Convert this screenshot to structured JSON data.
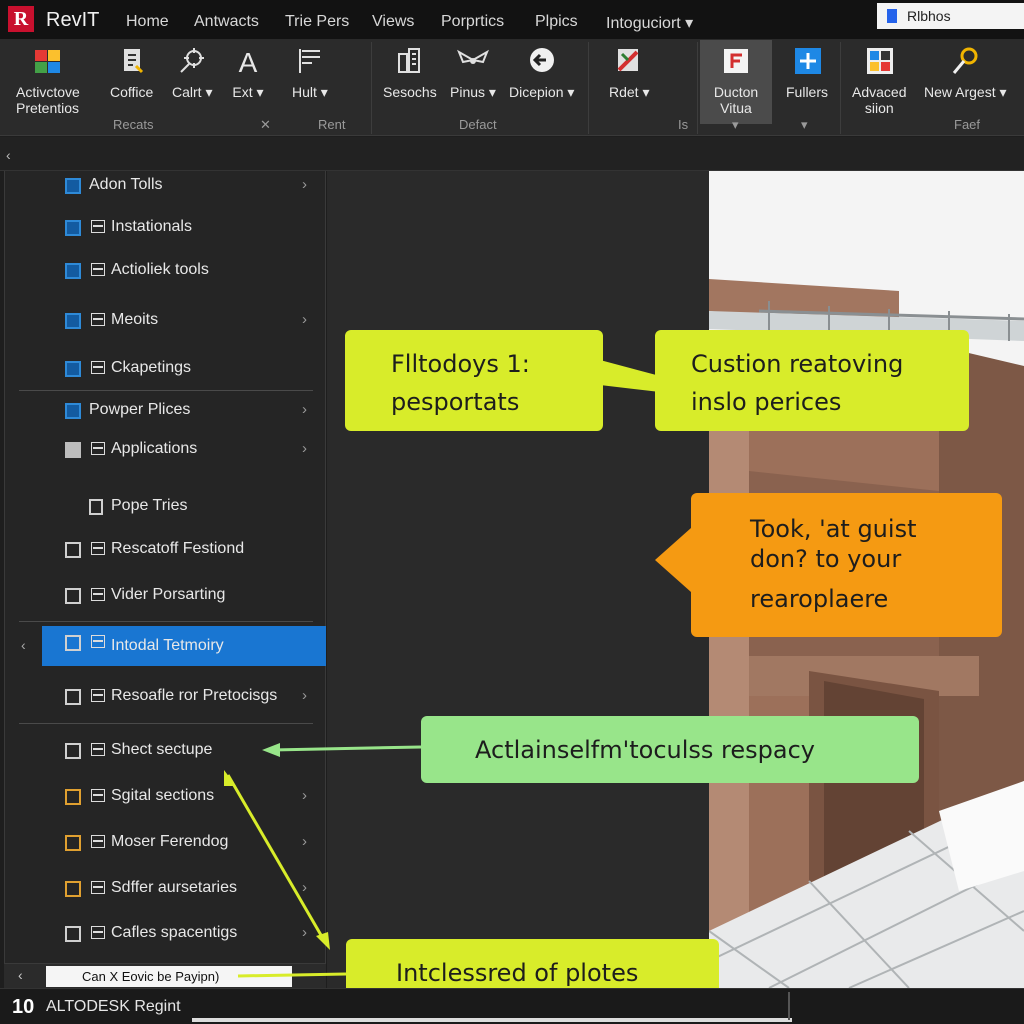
{
  "app": {
    "logo": "R",
    "title": "RevIT"
  },
  "menu": [
    "Home",
    "Antwacts",
    "Trie Pers",
    "Views",
    "Porprtics",
    "Plpics",
    "Intoguciort ▾"
  ],
  "search": {
    "value": "Rlbhos"
  },
  "ribbon": {
    "buttons": [
      {
        "label": "Activctove\nPretentios",
        "icon": "multicolor-box-icon"
      },
      {
        "label": "Coffice",
        "icon": "document-icon"
      },
      {
        "label": "Calrt ▾",
        "icon": "crosshair-icon"
      },
      {
        "label": "Ext ▾",
        "icon": "text-a-icon"
      },
      {
        "label": "Hult ▾",
        "icon": "flag-icon"
      },
      {
        "label": "Sesochs",
        "icon": "building-icon"
      },
      {
        "label": "Pinus ▾",
        "icon": "wings-icon"
      },
      {
        "label": "Dicepion ▾",
        "icon": "back-circle-icon"
      },
      {
        "label": "Rdet ▾",
        "icon": "red-green-tool-icon"
      },
      {
        "label": "Ducton\nVitua",
        "icon": "red-f-icon"
      },
      {
        "label": "Fullers",
        "icon": "blue-plus-icon"
      },
      {
        "label": "Advaced\nsiion",
        "icon": "grid-colors-icon"
      },
      {
        "label": "New Argest ▾",
        "icon": "key-search-icon"
      }
    ],
    "groups": [
      "Recats",
      "✕",
      "Rent",
      "Defact",
      "Is",
      "▾",
      "▾",
      "Faef"
    ]
  },
  "sidebar": {
    "items": [
      {
        "label": "Adon Tolls",
        "icon": "folder-blue-icon",
        "arrow": "›"
      },
      {
        "label": "Instationals",
        "icon": "folder-blue-icon",
        "arrow": ""
      },
      {
        "label": "Actioliek tools",
        "icon": "folder-blue-icon",
        "arrow": ""
      },
      {
        "label": "Meoits",
        "icon": "folder-blue-icon",
        "arrow": "›"
      },
      {
        "label": "Ckapetings",
        "icon": "folder-blue-icon",
        "arrow": ""
      },
      {
        "label": "Powper Plices",
        "icon": "folder-blue-icon",
        "arrow": "›"
      },
      {
        "label": "Applications",
        "icon": "folder-gray-icon",
        "arrow": "›"
      },
      {
        "label": "Pope Tries",
        "icon": "building-small-icon",
        "arrow": ""
      },
      {
        "label": "Rescatoff Festiond",
        "icon": "doc-grid-icon",
        "arrow": ""
      },
      {
        "label": "Vider Porsarting",
        "icon": "doc-grid-icon",
        "arrow": ""
      },
      {
        "label": "Intodal Tetmoiry",
        "icon": "doc-grid-icon",
        "arrow": ""
      },
      {
        "label": "Resoafle ror Pretocisgs",
        "icon": "doc-grid-icon",
        "arrow": "›"
      },
      {
        "label": "Shect sectupe",
        "icon": "doc-grid-icon",
        "arrow": ""
      },
      {
        "label": "Sgital sections",
        "icon": "folder-orange-icon",
        "arrow": "›"
      },
      {
        "label": "Moser Ferendog",
        "icon": "folder-orange-icon",
        "arrow": "›"
      },
      {
        "label": "Sdffer aursetaries",
        "icon": "folder-orange-icon",
        "arrow": "›"
      },
      {
        "label": "Cafles spacentigs",
        "icon": "doc-white-icon",
        "arrow": "›"
      }
    ],
    "collapse_chevron": "‹",
    "bottom_chevron": "‹",
    "command_value": "Can X Eovic be Payipn)"
  },
  "strip": {
    "chevron": "‹"
  },
  "status": {
    "number": "10",
    "text": "ALTODESK Regint"
  },
  "callouts": [
    {
      "line1": "Flltodoys 1:",
      "line2": "pesportats"
    },
    {
      "line1": "Custion reatoving",
      "line2": "inslo perices"
    },
    {
      "line1": "Took, 'at guist",
      "line2": "don? to your",
      "line3": "rearoplaere"
    },
    {
      "line1": "Actlainselfm'toculss respacy"
    },
    {
      "line1": "Intclessred of plotes"
    }
  ],
  "colors": {
    "accent": "#1976d2",
    "callout_yellow": "#d8ec2a",
    "callout_orange": "#f59a12",
    "callout_green": "#98e58a",
    "logo_red": "#c8102e"
  }
}
